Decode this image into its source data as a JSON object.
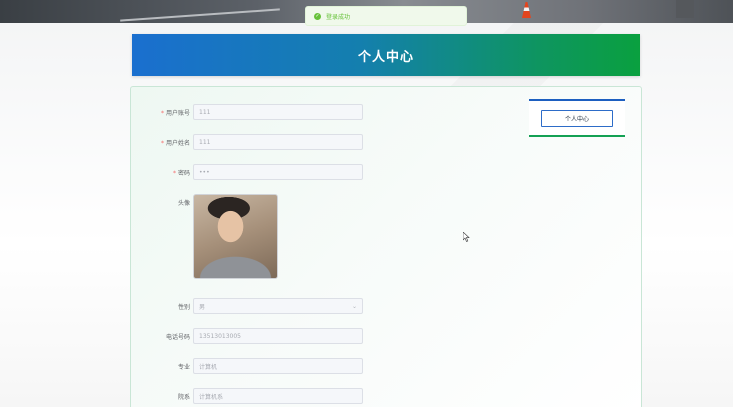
{
  "toast": {
    "message": "登录成功",
    "icon": "check-circle-icon"
  },
  "header": {
    "title": "个人中心"
  },
  "form": {
    "account": {
      "label": "用户账号",
      "value": "111",
      "required": true
    },
    "name": {
      "label": "用户姓名",
      "value": "111",
      "required": true
    },
    "password": {
      "label": "密码",
      "value": "•••",
      "required": true
    },
    "avatar": {
      "label": "头像"
    },
    "gender": {
      "label": "性别",
      "value": "男"
    },
    "phone": {
      "label": "电话号码",
      "value": "13513013005"
    },
    "major": {
      "label": "专业",
      "value": "计算机"
    },
    "department": {
      "label": "院系",
      "value": "计算机系"
    }
  },
  "side_menu": {
    "button_label": "个人中心"
  },
  "colors": {
    "header_start": "#1a6fcf",
    "header_end": "#0aa03f",
    "success": "#67c23a",
    "required": "#f56c6c"
  }
}
